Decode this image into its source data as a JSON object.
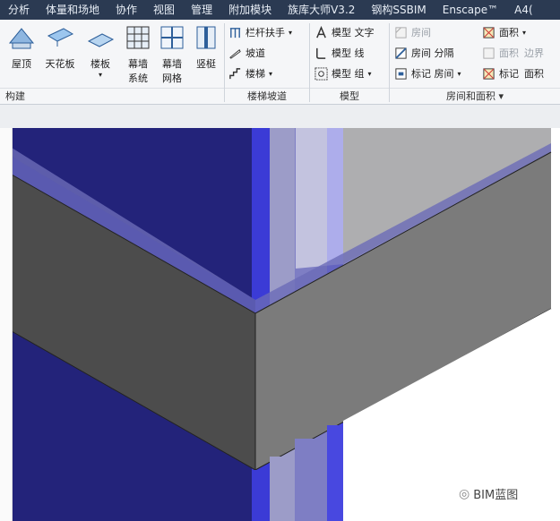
{
  "menu": [
    "分析",
    "体量和场地",
    "协作",
    "视图",
    "管理",
    "附加模块",
    "族库大师V3.2",
    "钢构SSBIM",
    "Enscape™",
    "A4("
  ],
  "build": {
    "roof": "屋顶",
    "ceiling": "天花板",
    "floor": "楼板",
    "curtain_system": "幕墙\n系统",
    "curtain_grid": "幕墙\n网格",
    "mullion": "竖梃",
    "group": "构建"
  },
  "stairs": {
    "railing": "栏杆扶手",
    "ramp": "坡道",
    "stair": "楼梯",
    "group": "楼梯坡道"
  },
  "model": {
    "text": "模型 文字",
    "line": "模型 线",
    "group_btn": "模型 组",
    "group": "模型"
  },
  "room": {
    "room": "房间",
    "area": "面积",
    "room_sep": "房间 分隔",
    "area_dim": "面积",
    "boundary": "边界",
    "tag_room": "标记 房间",
    "tag_area": "标记",
    "area_short": "面积",
    "group": "房间和面积"
  },
  "watermark": "BIM蓝图",
  "colors": {
    "accent": "#2b3a52",
    "glass": "#23237a",
    "wall_dark": "#4a4a4a",
    "wall_light": "#7a7a7a",
    "roof": "#a8a8a8"
  }
}
